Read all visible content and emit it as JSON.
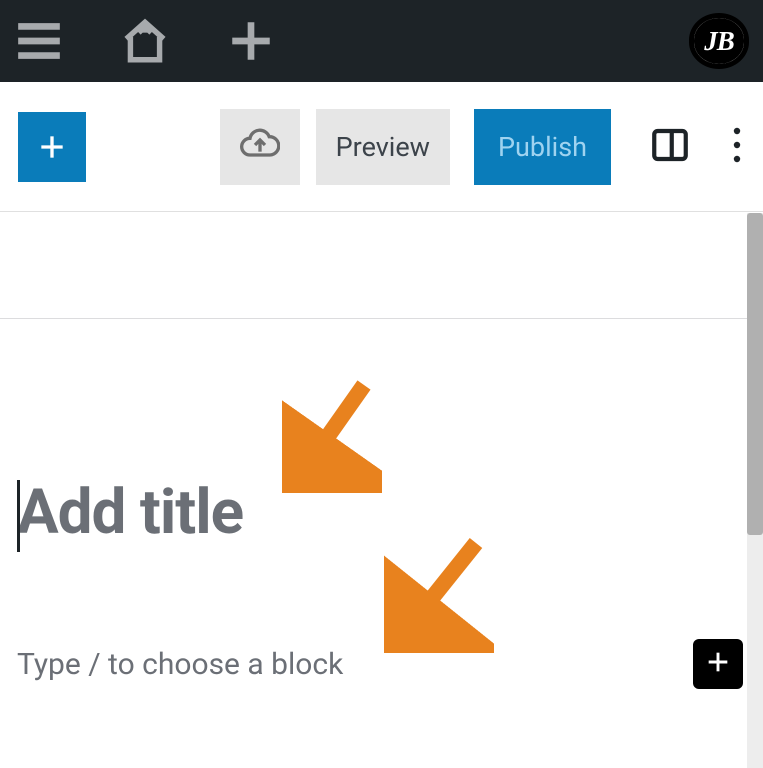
{
  "admin_bar": {
    "logo_text": "JB"
  },
  "toolbar": {
    "preview_label": "Preview",
    "publish_label": "Publish"
  },
  "editor": {
    "title_placeholder": "Add title",
    "block_placeholder": "Type / to choose a block"
  },
  "icons": {
    "menu": "menu-icon",
    "home": "home-icon",
    "plus": "plus-icon",
    "cloud_save": "cloud-upload-icon",
    "sidebar": "sidebar-toggle-icon",
    "more": "more-vertical-icon",
    "inline_add": "plus-icon"
  },
  "colors": {
    "accent": "#0a7cba",
    "admin_bg": "#1d2327",
    "arrow": "#e8821e"
  }
}
